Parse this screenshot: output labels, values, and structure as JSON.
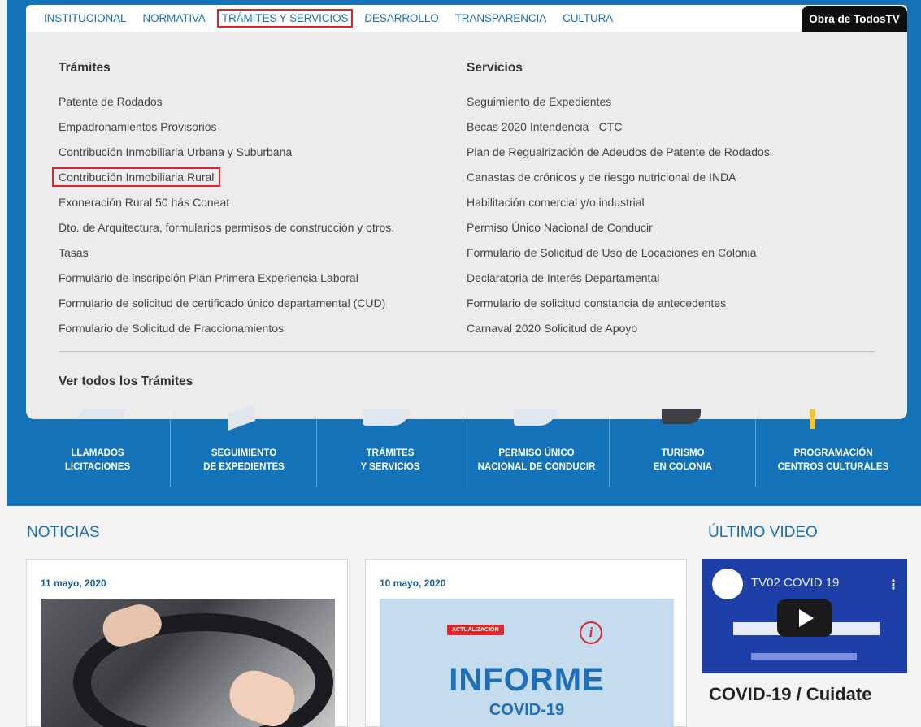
{
  "nav": {
    "items": [
      "INSTITUCIONAL",
      "NORMATIVA",
      "TRÁMITES Y SERVICIOS",
      "DESARROLLO",
      "TRANSPARENCIA",
      "CULTURA"
    ],
    "active_index": 2,
    "tv_button": "Obra de TodosTV"
  },
  "dropdown": {
    "tramites": {
      "heading": "Trámites",
      "items": [
        "Patente de Rodados",
        "Empadronamientos Provisorios",
        "Contribución Inmobiliaria Urbana y Suburbana",
        "Contribución Inmobiliaria Rural",
        "Exoneración Rural 50 hás Coneat",
        "Dto. de Arquitectura, formularios permisos de construcción y otros.",
        "Tasas",
        "Formulario de inscripción Plan Primera Experiencia Laboral",
        "Formulario de solicitud de certificado único departamental (CUD)",
        "Formulario de Solicitud de Fraccionamientos"
      ],
      "highlight_index": 3
    },
    "servicios": {
      "heading": "Servicios",
      "items": [
        "Seguimiento de Expedientes",
        "Becas 2020 Intendencia - CTC",
        "Plan de Regualrización de Adeudos de Patente de Rodados",
        "Canastas de crónicos y de riesgo nutricional de INDA",
        "Habilitación comercial y/o industrial",
        "Permiso Único Nacional de Conducir",
        "Formulario de Solicitud de Uso de Locaciones en Colonia",
        "Declaratoria de Interés Departamental",
        "Formulario de solicitud constancia de antecedentes",
        "Carnaval 2020 Solicitud de Apoyo"
      ]
    },
    "ver_todos": "Ver todos los Trámites"
  },
  "quick_links": [
    {
      "line1": "LLAMADOS",
      "line2": "LICITACIONES"
    },
    {
      "line1": "SEGUIMIENTO",
      "line2": "DE EXPEDIENTES"
    },
    {
      "line1": "TRÁMITES",
      "line2": "Y SERVICIOS"
    },
    {
      "line1": "PERMISO ÚNICO",
      "line2": "NACIONAL DE CONDUCIR"
    },
    {
      "line1": "TURISMO",
      "line2": "EN COLONIA"
    },
    {
      "line1": "PROGRAMACIÓN",
      "line2": "CENTROS CULTURALES"
    }
  ],
  "news": {
    "title": "NOTICIAS",
    "cards": [
      {
        "date": "11 mayo, 2020"
      },
      {
        "date": "10 mayo, 2020",
        "badge": "ACTUALIZACIÓN",
        "headline": "INFORME",
        "subheadline": "COVID-19"
      }
    ]
  },
  "video": {
    "section_title": "ÚLTIMO VIDEO",
    "title": "TV02 COVID 19",
    "caption": "COVID-19 / Cuidate"
  },
  "colors": {
    "brand_blue": "#1473b8",
    "link_blue": "#1a6fb5",
    "highlight_red": "#e0252a"
  }
}
